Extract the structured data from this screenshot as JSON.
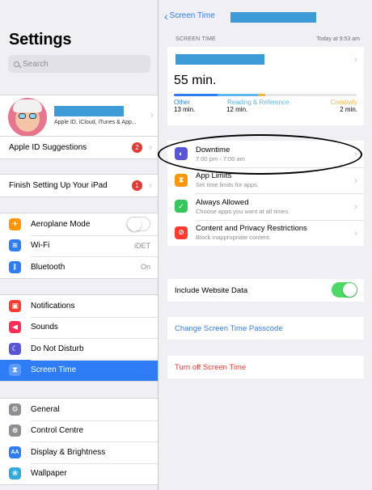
{
  "colors": {
    "accent": "#2f7df6",
    "destructive": "#e53935",
    "toggle_on": "#4cd964"
  },
  "sidebar": {
    "title": "Settings",
    "search_placeholder": "Search",
    "profile": {
      "name_redacted": true,
      "subtitle": "Apple ID, iCloud, iTunes & App..."
    },
    "apple_id_suggestions": {
      "label": "Apple ID Suggestions",
      "badge": "2"
    },
    "finish_setup": {
      "label": "Finish Setting Up Your iPad",
      "badge": "1"
    },
    "connectivity": [
      {
        "label": "Aeroplane Mode",
        "icon": "airplane-icon",
        "color": "#ff9500",
        "toggle": "off"
      },
      {
        "label": "Wi-Fi",
        "icon": "wifi-icon",
        "color": "#2f7df6",
        "value": "iDET"
      },
      {
        "label": "Bluetooth",
        "icon": "bluetooth-icon",
        "color": "#2f7df6",
        "value": "On"
      }
    ],
    "system": [
      {
        "label": "Notifications",
        "icon": "notifications-icon",
        "color": "#ff3b30"
      },
      {
        "label": "Sounds",
        "icon": "sounds-icon",
        "color": "#ff2d55"
      },
      {
        "label": "Do Not Disturb",
        "icon": "moon-icon",
        "color": "#5856d6"
      },
      {
        "label": "Screen Time",
        "icon": "hourglass-icon",
        "color": "#5856d6",
        "selected": true
      }
    ],
    "general": [
      {
        "label": "General",
        "icon": "gear-icon",
        "color": "#8e8e93"
      },
      {
        "label": "Control Centre",
        "icon": "switches-icon",
        "color": "#8e8e93"
      },
      {
        "label": "Display & Brightness",
        "icon": "display-icon",
        "color": "#2f7df6"
      },
      {
        "label": "Wallpaper",
        "icon": "wallpaper-icon",
        "color": "#34aadc"
      }
    ]
  },
  "main": {
    "back_label": "Screen Time",
    "caption": "SCREEN TIME",
    "today": "Today at 9:53 am",
    "usage": {
      "total": "55 min.",
      "categories": [
        {
          "name": "Other",
          "time": "13 min.",
          "color": "#2f7df6",
          "fraction": 0.24
        },
        {
          "name": "Reading & Reference",
          "time": "12 min.",
          "color": "#59b7ea",
          "fraction": 0.22
        },
        {
          "name": "Creativity",
          "time": "2 min.",
          "color": "#f5b43a",
          "fraction": 0.04
        }
      ]
    },
    "items": [
      {
        "title": "Downtime",
        "subtitle": "7:00 pm - 7:00 am",
        "icon": "downtime-icon",
        "color": "#5856d6"
      },
      {
        "title": "App Limits",
        "subtitle": "Set time limits for apps.",
        "icon": "hourglass-icon",
        "color": "#ff9500"
      },
      {
        "title": "Always Allowed",
        "subtitle": "Choose apps you want at all times.",
        "icon": "checkmark-icon",
        "color": "#34c759"
      },
      {
        "title": "Content and Privacy Restrictions",
        "subtitle": "Block inappropriate content.",
        "icon": "restriction-icon",
        "color": "#ff3b30"
      }
    ],
    "website_data": {
      "label": "Include Website Data",
      "toggle": "on"
    },
    "passcode_label": "Change Screen Time Passcode",
    "turn_off_label": "Turn off Screen Time"
  }
}
